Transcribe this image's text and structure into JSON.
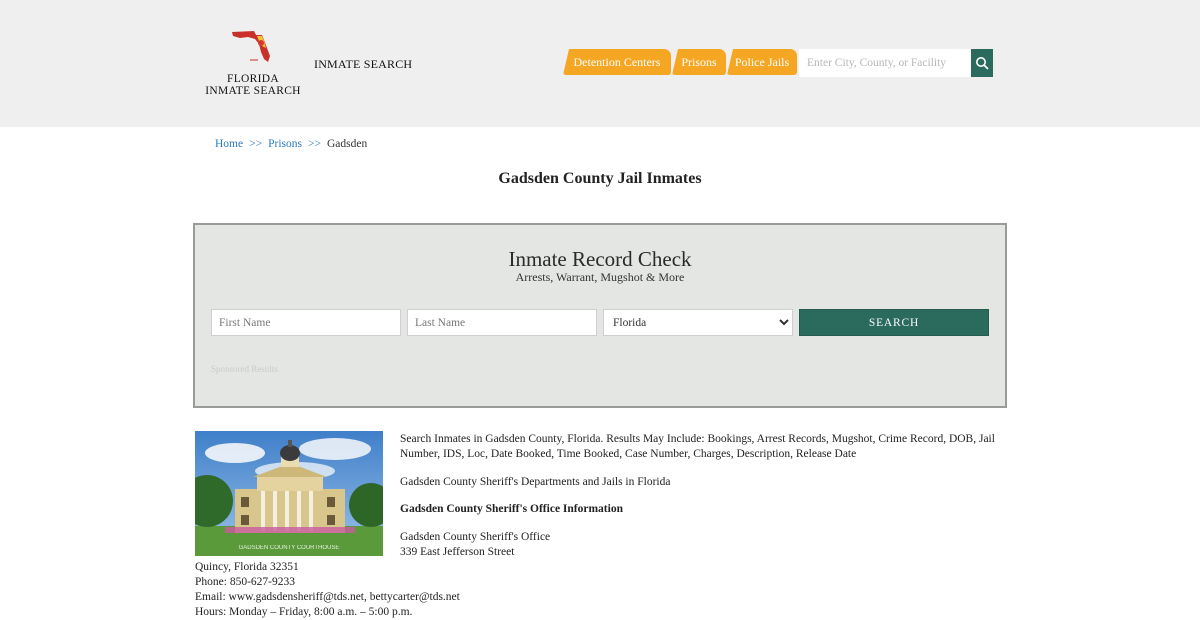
{
  "header": {
    "logo_line1": "FLORIDA",
    "logo_line2": "INMATE SEARCH",
    "brand_link": "INMATE SEARCH",
    "nav": [
      {
        "label": "Detention Centers"
      },
      {
        "label": "Prisons"
      },
      {
        "label": "Police Jails"
      }
    ],
    "search_placeholder": "Enter City, County, or Facility",
    "accent_color": "#f5a623",
    "button_color": "#2a6b5d"
  },
  "breadcrumb": {
    "home": "Home",
    "separator": ">>",
    "prisons": "Prisons",
    "current": "Gadsden"
  },
  "page_title": "Gadsden County Jail Inmates",
  "record_check": {
    "title": "Inmate Record Check",
    "subtitle": "Arrests, Warrant, Mugshot & More",
    "first_name_placeholder": "First Name",
    "last_name_placeholder": "Last Name",
    "state_selected": "Florida",
    "search_label": "SEARCH",
    "sponsored": "Sponsored Results"
  },
  "content": {
    "photo_watermark": "GADSDEN COUNTY COURTHOUSE",
    "description": "Search Inmates in Gadsden County, Florida. Results May Include: Bookings, Arrest Records, Mugshot, Crime Record, DOB, Jail Number, IDS, Loc, Date Booked, Time Booked, Case Number, Charges, Description, Release Date",
    "departments": "Gadsden County Sheriff's Departments and Jails in Florida",
    "office_heading": "Gadsden County Sheriff's Office Information",
    "office_name": "Gadsden County Sheriff's Office",
    "address_line1": "339 East Jefferson Street",
    "address_line2": "Quincy, Florida 32351",
    "phone": "Phone: 850-627-9233",
    "email": "Email: www.gadsdensheriff@tds.net, bettycarter@tds.net",
    "hours": "Hours: Monday – Friday, 8:00 a.m. – 5:00 p.m."
  }
}
